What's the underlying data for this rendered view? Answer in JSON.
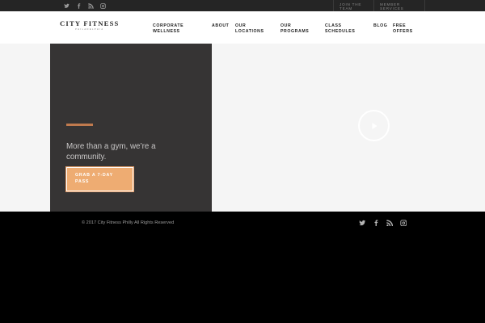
{
  "topbar": {
    "social_icons": [
      "twitter-icon",
      "facebook-icon",
      "rss-icon",
      "instagram-icon"
    ],
    "links": [
      {
        "label": "JOIN THE TEAM"
      },
      {
        "label": "MEMBER SERVICES"
      }
    ]
  },
  "header": {
    "logo": {
      "name": "CITY FITNESS",
      "subtitle": "PHILADELPHIA"
    },
    "nav": [
      {
        "label": "CORPORATE\nWELLNESS"
      },
      {
        "label": "ABOUT"
      },
      {
        "label": "OUR\nLOCATIONS"
      },
      {
        "label": "OUR\nPROGRAMS"
      },
      {
        "label": "CLASS\nSCHEDULES"
      },
      {
        "label": "BLOG"
      },
      {
        "label": "FREE\nOFFERS"
      }
    ]
  },
  "hero": {
    "tagline": "More than a gym, we’re a community.",
    "cta_label": "GRAB A 7-DAY\nPASS",
    "play_icon": "play-icon",
    "colors": {
      "card": "#363434",
      "accent": "#c07a4e",
      "cta": "#eeac72"
    }
  },
  "footer": {
    "copyright": "© 2017 City Fitness Philly All Rights Reserved",
    "social_icons": [
      "twitter-icon",
      "facebook-icon",
      "rss-icon",
      "instagram-icon"
    ]
  }
}
